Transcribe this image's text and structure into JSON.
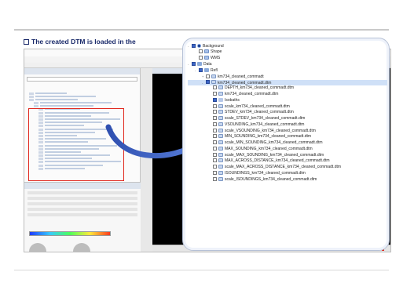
{
  "headline": "The created DTM is loaded in the",
  "colors": {
    "accent": "#1a2a6a",
    "highlight_box": "#e0281e",
    "arrow": "#3b5fbf",
    "viewer_bg": "#000000"
  },
  "icons": {
    "headline_bullet": "checkbox-bullet-icon",
    "arrow": "curved-arrow-icon"
  },
  "tree": [
    {
      "label": "Background",
      "indent": 0,
      "expander": "-",
      "checked": true,
      "icon": "globe-icon"
    },
    {
      "label": "Shape",
      "indent": 1,
      "expander": "",
      "checked": false,
      "icon": "layer-icon"
    },
    {
      "label": "WMS",
      "indent": 1,
      "expander": "",
      "checked": false,
      "icon": "layer-icon"
    },
    {
      "label": "Data",
      "indent": 0,
      "expander": "-",
      "checked": true,
      "icon": "data-icon"
    },
    {
      "label": "Refl",
      "indent": 1,
      "expander": "-",
      "checked": true,
      "icon": "data-icon"
    },
    {
      "label": "km734_cleaned_commadt",
      "indent": 2,
      "expander": "+",
      "checked": false,
      "icon": "dtm-icon"
    },
    {
      "label": "km734_cleaned_commadt.dtm",
      "indent": 2,
      "expander": "-",
      "checked": true,
      "icon": "dtm-icon",
      "selected": true
    },
    {
      "label": "DEPTH_km734_cleaned_commadt.dtm",
      "indent": 3,
      "expander": "",
      "checked": false,
      "icon": "dtm-icon"
    },
    {
      "label": "km734_cleaned_commadt.dtm",
      "indent": 3,
      "expander": "",
      "checked": false,
      "icon": "dtm-icon"
    },
    {
      "label": "Isobaths",
      "indent": 3,
      "expander": "",
      "checked": true,
      "icon": "iso-icon"
    },
    {
      "label": "scale_km734_cleaned_commadt.dtm",
      "indent": 3,
      "expander": "",
      "checked": false,
      "icon": "dtm-icon"
    },
    {
      "label": "STDEV_km734_cleaned_commadt.dtm",
      "indent": 3,
      "expander": "",
      "checked": false,
      "icon": "dtm-icon"
    },
    {
      "label": "scale_STDEV_km734_cleaned_commadt.dtm",
      "indent": 3,
      "expander": "",
      "checked": false,
      "icon": "dtm-icon"
    },
    {
      "label": "VSOUNDING_km734_cleaned_commadt.dtm",
      "indent": 3,
      "expander": "",
      "checked": false,
      "icon": "dtm-icon"
    },
    {
      "label": "scale_VSOUNDING_km734_cleaned_commadt.dtm",
      "indent": 3,
      "expander": "",
      "checked": false,
      "icon": "dtm-icon"
    },
    {
      "label": "MIN_SOUNDING_km734_cleaned_commadt.dtm",
      "indent": 3,
      "expander": "",
      "checked": false,
      "icon": "dtm-icon"
    },
    {
      "label": "scale_MIN_SOUNDING_km734_cleaned_commadt.dtm",
      "indent": 3,
      "expander": "",
      "checked": false,
      "icon": "dtm-icon"
    },
    {
      "label": "MAX_SOUNDING_km734_cleaned_commadt.dtm",
      "indent": 3,
      "expander": "",
      "checked": false,
      "icon": "dtm-icon"
    },
    {
      "label": "scale_MAX_SOUNDING_km734_cleaned_commadt.dtm",
      "indent": 3,
      "expander": "",
      "checked": false,
      "icon": "dtm-icon"
    },
    {
      "label": "MAX_ACROSS_DISTANCE_km734_cleaned_commadt.dtm",
      "indent": 3,
      "expander": "",
      "checked": false,
      "icon": "dtm-icon"
    },
    {
      "label": "scale_MAX_ACROSS_DISTANCE_km734_cleaned_commadt.dtm",
      "indent": 3,
      "expander": "",
      "checked": false,
      "icon": "dtm-icon"
    },
    {
      "label": "ISOUNDINGS_km734_cleaned_commadt.dtm",
      "indent": 3,
      "expander": "",
      "checked": false,
      "icon": "dtm-icon"
    },
    {
      "label": "scale_ISOUNDINGS_km734_cleaned_commadt.dtm",
      "indent": 3,
      "expander": "",
      "checked": false,
      "icon": "dtm-icon"
    }
  ]
}
